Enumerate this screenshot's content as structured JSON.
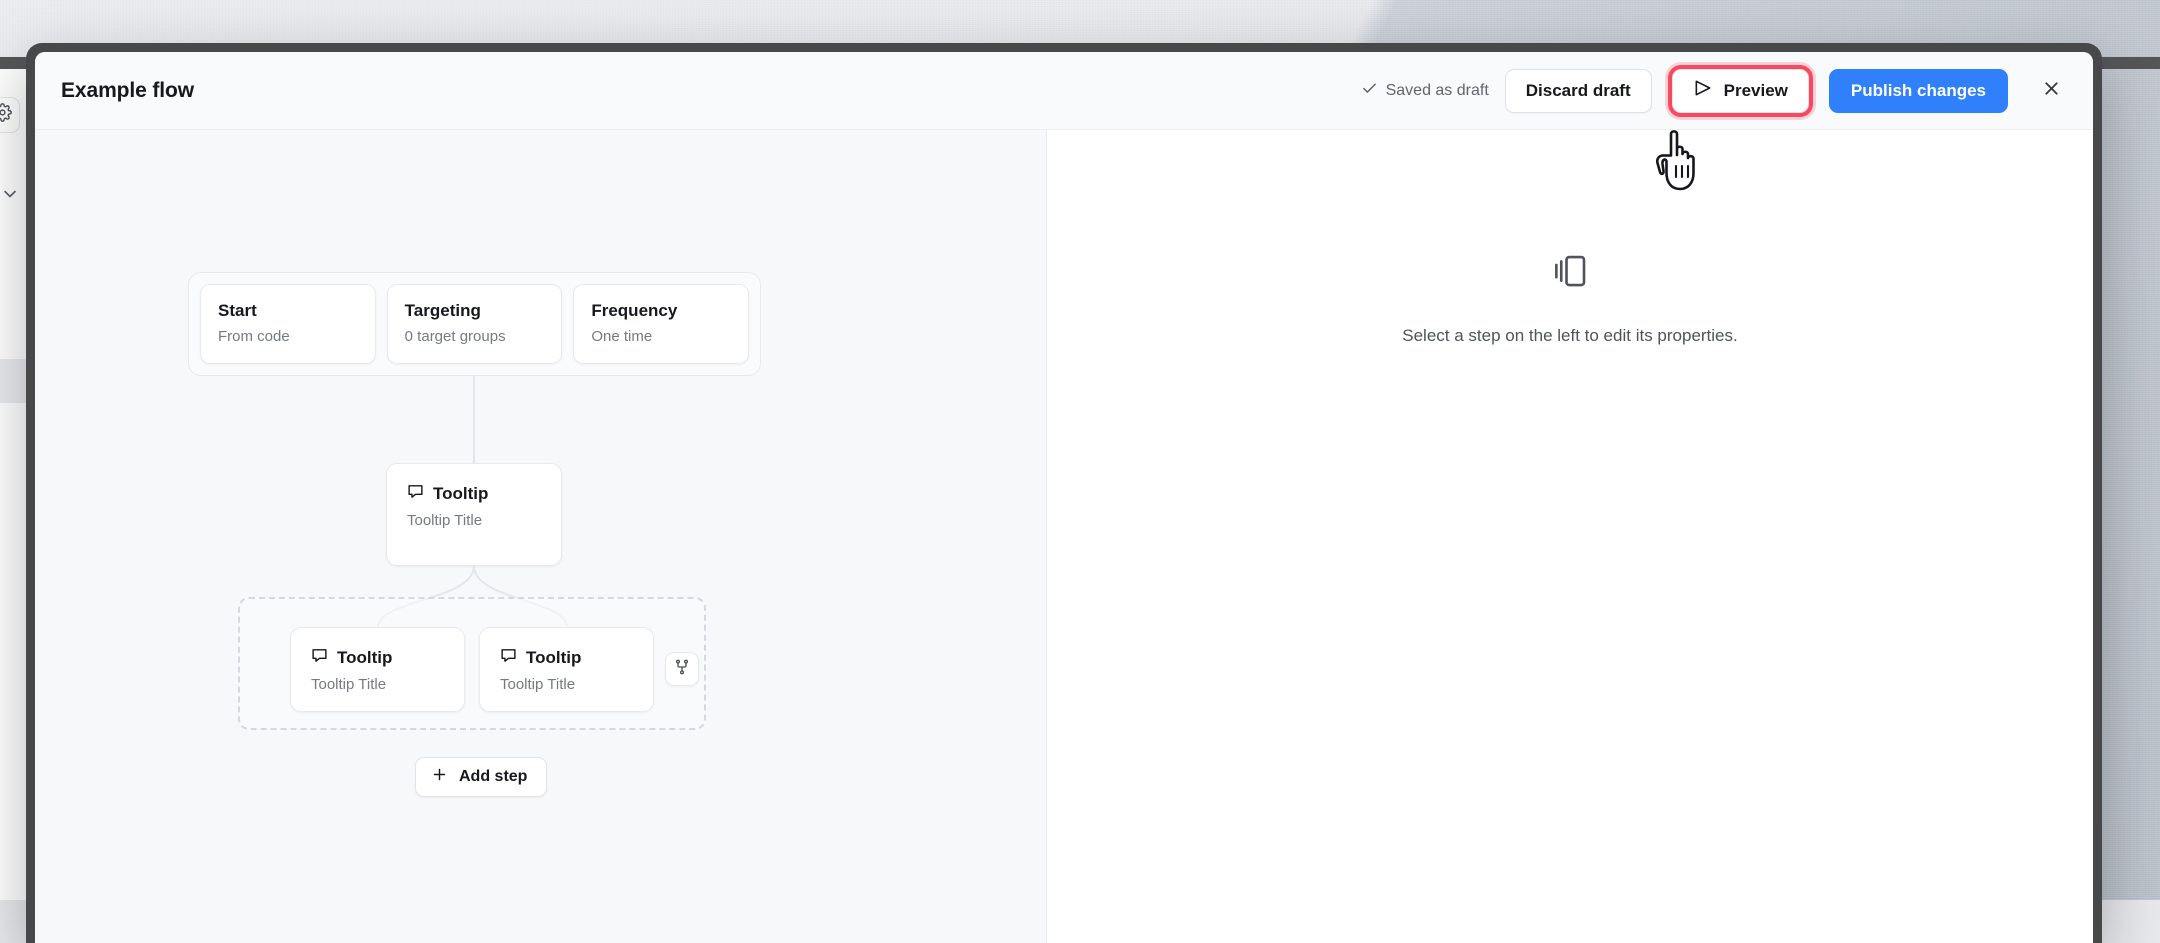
{
  "window": {
    "background_color": "#e7e9ec",
    "frame_color": "#47484a"
  },
  "bg_sidebar": {
    "gear_icon": "gear-icon",
    "chevron_icon": "chevron-down-icon"
  },
  "header": {
    "title": "Example flow",
    "saved_status": "Saved as draft",
    "saved_status_icon": "check-icon",
    "discard_label": "Discard draft",
    "preview_label": "Preview",
    "preview_icon": "send-triangle-icon",
    "preview_highlight_color": "#f8495f",
    "publish_label": "Publish changes",
    "publish_color": "#2f80fa",
    "close_icon": "close-icon"
  },
  "canvas": {
    "meta_cards": [
      {
        "title": "Start",
        "subtitle": "From code"
      },
      {
        "title": "Targeting",
        "subtitle": "0 target groups"
      },
      {
        "title": "Frequency",
        "subtitle": "One time"
      }
    ],
    "root_step": {
      "type": "Tooltip",
      "title": "Tooltip Title",
      "icon": "message-square-icon"
    },
    "branch_steps": [
      {
        "type": "Tooltip",
        "title": "Tooltip Title",
        "icon": "message-square-icon"
      },
      {
        "type": "Tooltip",
        "title": "Tooltip Title",
        "icon": "message-square-icon"
      }
    ],
    "branch_button_icon": "git-branch-icon",
    "add_step_label": "Add step",
    "add_step_icon": "plus-icon"
  },
  "detail_panel": {
    "empty_icon": "card-stack-icon",
    "empty_message": "Select a step on the left to edit its properties."
  },
  "cursor": {
    "type": "pointing-hand-cursor"
  }
}
